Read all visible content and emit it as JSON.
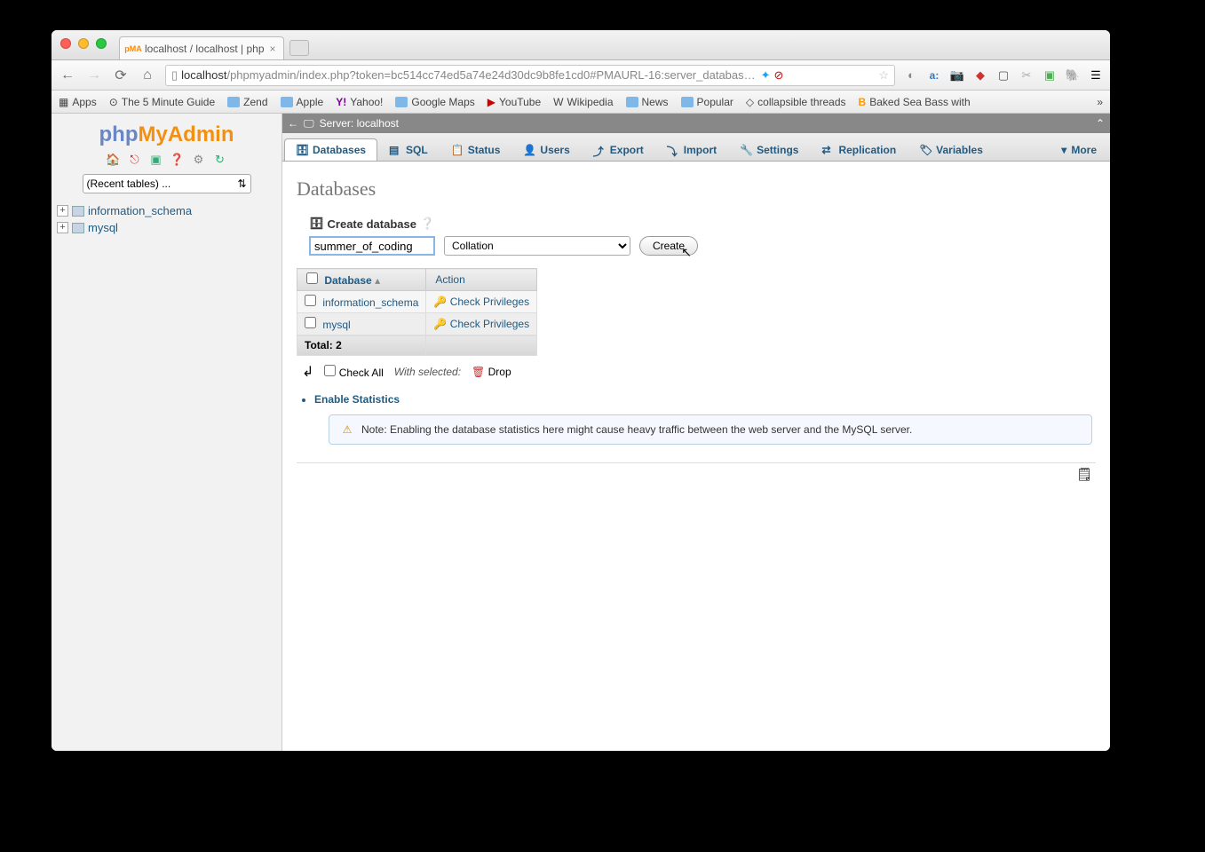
{
  "browser": {
    "tab_title": "localhost / localhost | php",
    "url_host": "localhost",
    "url_rest": "/phpmyadmin/index.php?token=bc514cc74ed5a74e24d30dc9b8fe1cd0#PMAURL-16:server_databas…",
    "bookmarks": [
      "Apps",
      "The 5 Minute Guide",
      "Zend",
      "Apple",
      "Yahoo!",
      "Google Maps",
      "YouTube",
      "Wikipedia",
      "News",
      "Popular",
      "collapsible threads",
      "Baked Sea Bass with"
    ],
    "more": "»"
  },
  "sidebar": {
    "recent": "(Recent tables) ...",
    "tree": [
      "information_schema",
      "mysql"
    ]
  },
  "server_label": "Server: localhost",
  "tabs": [
    "Databases",
    "SQL",
    "Status",
    "Users",
    "Export",
    "Import",
    "Settings",
    "Replication",
    "Variables",
    "More"
  ],
  "page_title": "Databases",
  "create": {
    "label": "Create database",
    "value": "summer_of_coding",
    "collation": "Collation",
    "button": "Create"
  },
  "table": {
    "headers": [
      "Database",
      "Action"
    ],
    "rows": [
      {
        "name": "information_schema",
        "action": "Check Privileges"
      },
      {
        "name": "mysql",
        "action": "Check Privileges"
      }
    ],
    "total_label": "Total: 2"
  },
  "bulk": {
    "check_all": "Check All",
    "with_selected": "With selected:",
    "drop": "Drop"
  },
  "enable_stats": "Enable Statistics",
  "note": "Note: Enabling the database statistics here might cause heavy traffic between the web server and the MySQL server."
}
